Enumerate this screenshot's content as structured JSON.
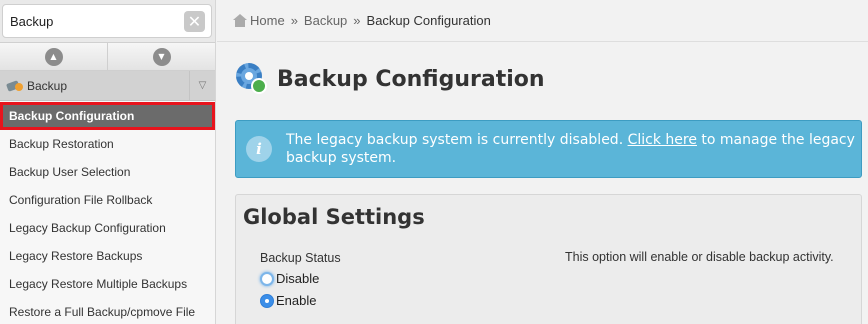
{
  "sidebar": {
    "search": {
      "value": "Backup",
      "clear_icon": "close-icon"
    },
    "collapse": {
      "up_icon": "chevron-up-icon",
      "down_icon": "chevron-down-icon"
    },
    "category": {
      "label": "Backup",
      "icon": "backup-icon",
      "chevron": "chevron-down-icon"
    },
    "items": [
      {
        "label": "Backup Configuration",
        "active": true
      },
      {
        "label": "Backup Restoration"
      },
      {
        "label": "Backup User Selection"
      },
      {
        "label": "Configuration File Rollback"
      },
      {
        "label": "Legacy Backup Configuration"
      },
      {
        "label": "Legacy Restore Backups"
      },
      {
        "label": "Legacy Restore Multiple Backups"
      },
      {
        "label": "Restore a Full Backup/cpmove File"
      }
    ]
  },
  "breadcrumb": {
    "home": "Home",
    "parent": "Backup",
    "current": "Backup Configuration",
    "separator": "»"
  },
  "page": {
    "title": "Backup Configuration",
    "alert": {
      "text_before": "The legacy backup system is currently disabled. ",
      "link": "Click here",
      "text_after": " to manage the legacy backup system.",
      "icon": "info-icon",
      "color": "#5bb5d8"
    },
    "global_settings": {
      "title": "Global Settings",
      "field_label": "Backup Status",
      "options": [
        {
          "label": "Disable",
          "checked": false
        },
        {
          "label": "Enable",
          "checked": true
        }
      ],
      "help": "This option will enable or disable backup activity."
    }
  },
  "colors": {
    "active_highlight": "#e8141d",
    "active_bg": "#6b6b6b",
    "radio_checked": "#3b8ee8"
  }
}
